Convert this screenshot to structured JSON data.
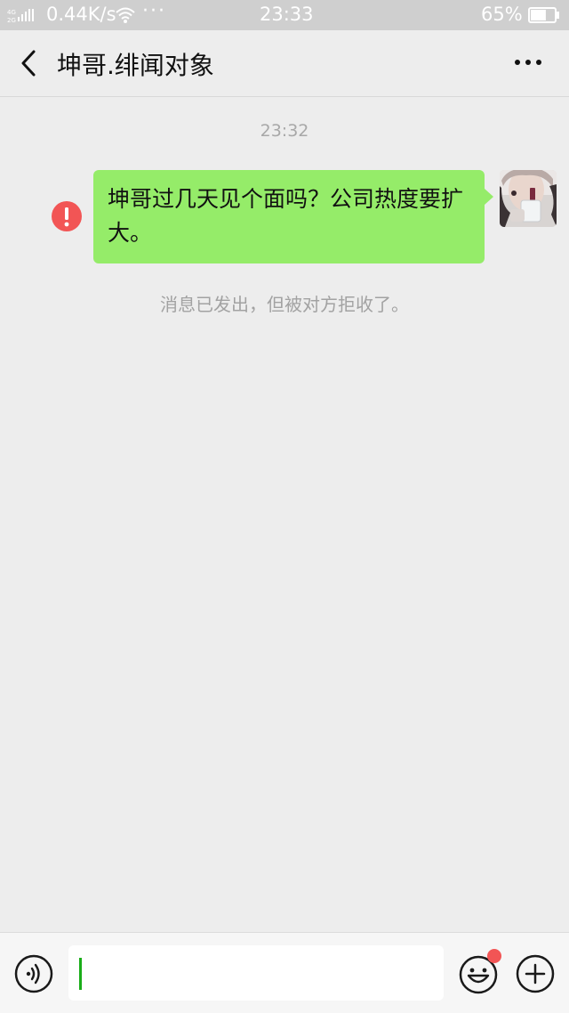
{
  "status_bar": {
    "network_label": "4G 2G",
    "speed": "0.44K/s",
    "more": "···",
    "time": "23:33",
    "battery_percent": "65%",
    "battery_level": 0.65,
    "icons": [
      "signal-icon",
      "wifi-icon",
      "battery-icon"
    ]
  },
  "header": {
    "title": "坤哥.绯闻对象",
    "back_icon": "chevron-left-icon",
    "more_icon": "more-dots-icon"
  },
  "messages": [
    {
      "timestamp": "23:32",
      "text": "坤哥过几天见个面吗？公司热度要扩大。",
      "direction": "outgoing",
      "status": "failed",
      "status_icon": "error-exclamation-icon",
      "bubble_color": "#95ec69"
    }
  ],
  "system_note": "消息已发出，但被对方拒收了。",
  "input_bar": {
    "voice_icon": "voice-icon",
    "emoji_icon": "emoji-icon",
    "plus_icon": "plus-icon",
    "input_value": "",
    "caret_color": "#1aad19"
  },
  "colors": {
    "background": "#ededed",
    "error_red": "#f25555",
    "bubble_green": "#95ec69"
  }
}
